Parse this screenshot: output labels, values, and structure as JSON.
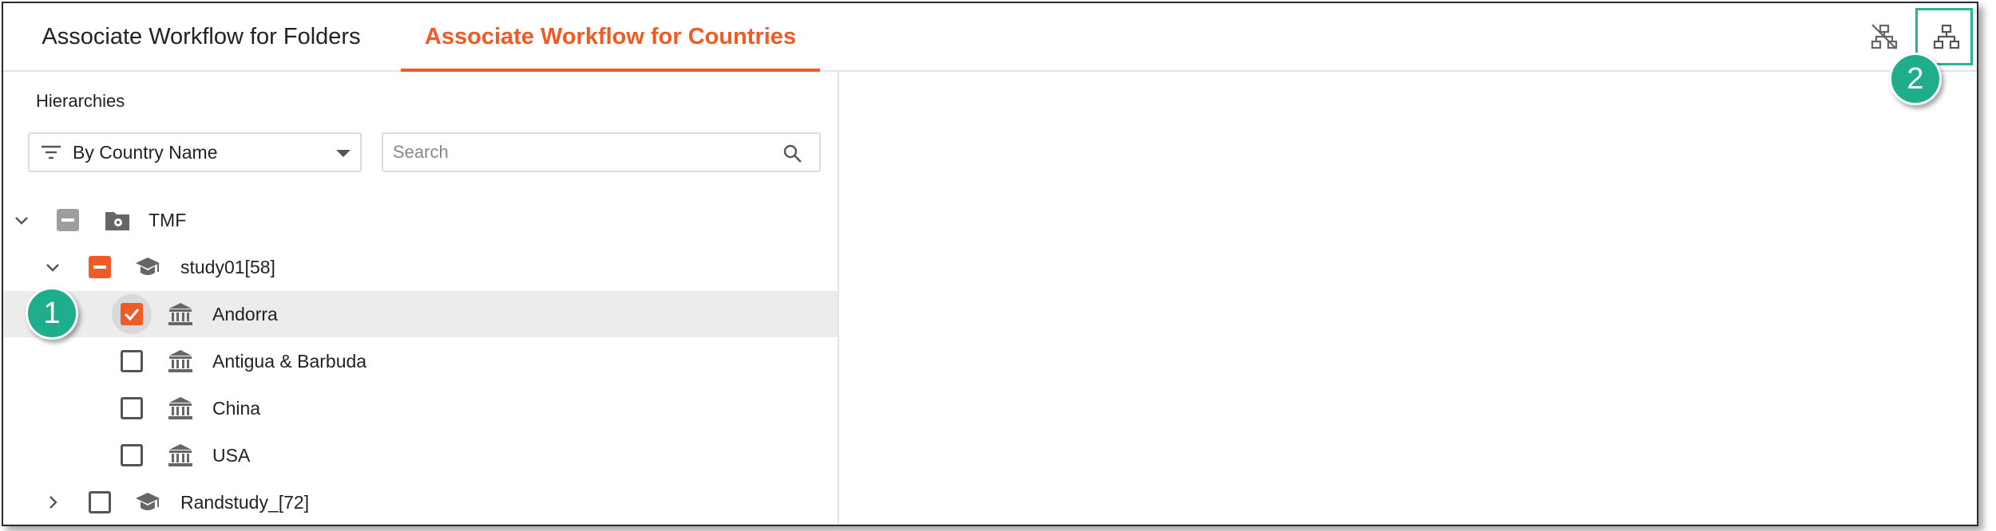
{
  "tabs": {
    "folders": "Associate Workflow for Folders",
    "countries": "Associate Workflow for Countries",
    "active": "countries"
  },
  "toolbar": {
    "icons": [
      "hierarchy-off-icon",
      "hierarchy-icon"
    ]
  },
  "panel": {
    "hierarchies_label": "Hierarchies",
    "dropdown_value": "By Country Name",
    "search_placeholder": "Search"
  },
  "tree": {
    "root": {
      "label": "TMF",
      "state": "partial",
      "expanded": true
    },
    "study01": {
      "label": "study01[58]",
      "state": "partial",
      "expanded": true
    },
    "andorra": {
      "label": "Andorra",
      "state": "checked"
    },
    "antigua": {
      "label": "Antigua & Barbuda",
      "state": "unchecked"
    },
    "china": {
      "label": "China",
      "state": "unchecked"
    },
    "usa": {
      "label": "USA",
      "state": "unchecked"
    },
    "randstudy": {
      "label": "Randstudy_[72]",
      "state": "unchecked",
      "expanded": false
    }
  },
  "callouts": {
    "one": "1",
    "two": "2"
  },
  "colors": {
    "accent": "#f05a24",
    "callout": "#1fae8c",
    "selected_row": "#ececec"
  }
}
